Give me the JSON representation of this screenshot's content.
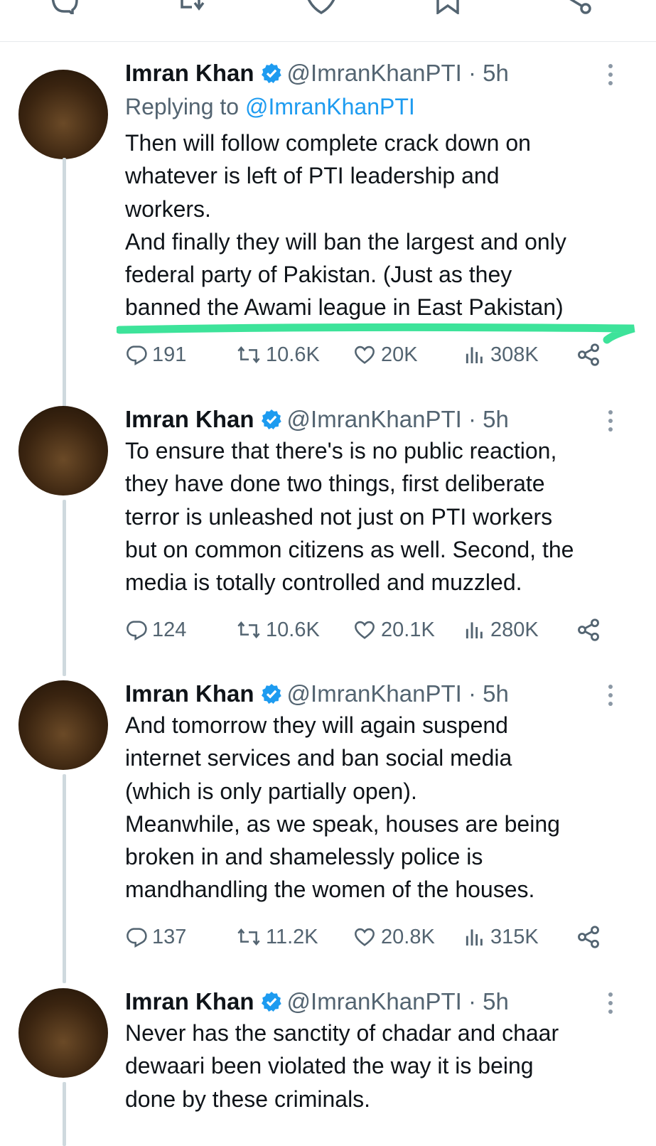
{
  "tweets": [
    {
      "name": "Imran Khan",
      "handle": "@ImranKhanPTI",
      "time": "· 5h",
      "replying_prefix": "Replying to ",
      "replying_to": "@ImranKhanPTI",
      "lines": [
        "Then will follow complete crack down on",
        "whatever is left of PTI leadership and",
        "workers.",
        "And finally they will ban the largest and only",
        "federal party of Pakistan. (Just as they",
        "banned the Awami league in East Pakistan)"
      ],
      "replies": "191",
      "reposts": "10.6K",
      "likes": "20K",
      "views": "308K"
    },
    {
      "name": "Imran Khan",
      "handle": "@ImranKhanPTI",
      "time": "· 5h",
      "lines": [
        "To ensure that there's is no public reaction,",
        "they have done two things, first deliberate",
        "terror is unleashed not just on PTI workers",
        "but on common citizens as well. Second, the",
        "media is totally controlled and muzzled."
      ],
      "replies": "124",
      "reposts": "10.6K",
      "likes": "20.1K",
      "views": "280K"
    },
    {
      "name": "Imran Khan",
      "handle": "@ImranKhanPTI",
      "time": "· 5h",
      "lines": [
        "And tomorrow they will again suspend",
        "internet services and ban social media",
        "(which is only partially open).",
        "Meanwhile, as we speak, houses are being",
        "broken in and shamelessly police is",
        "mandhandling the women of the houses."
      ],
      "replies": "137",
      "reposts": "11.2K",
      "likes": "20.8K",
      "views": "315K"
    },
    {
      "name": "Imran Khan",
      "handle": "@ImranKhanPTI",
      "time": "· 5h",
      "lines": [
        "Never has the sanctity of chadar and chaar",
        "dewaari been violated the way it is being",
        "done by these criminals."
      ]
    }
  ],
  "icons": {
    "reply": "reply-icon",
    "repost": "repost-icon",
    "like": "heart-icon",
    "views": "views-icon",
    "share": "share-icon",
    "bookmark": "bookmark-icon",
    "verified": "verified-badge-icon",
    "more": "more-icon"
  },
  "colors": {
    "text": "#0f1419",
    "muted": "#536471",
    "link": "#1d9bf0",
    "verified": "#1d9bf0",
    "highlight": "#3de39a",
    "thread_line": "#cfd9de"
  }
}
